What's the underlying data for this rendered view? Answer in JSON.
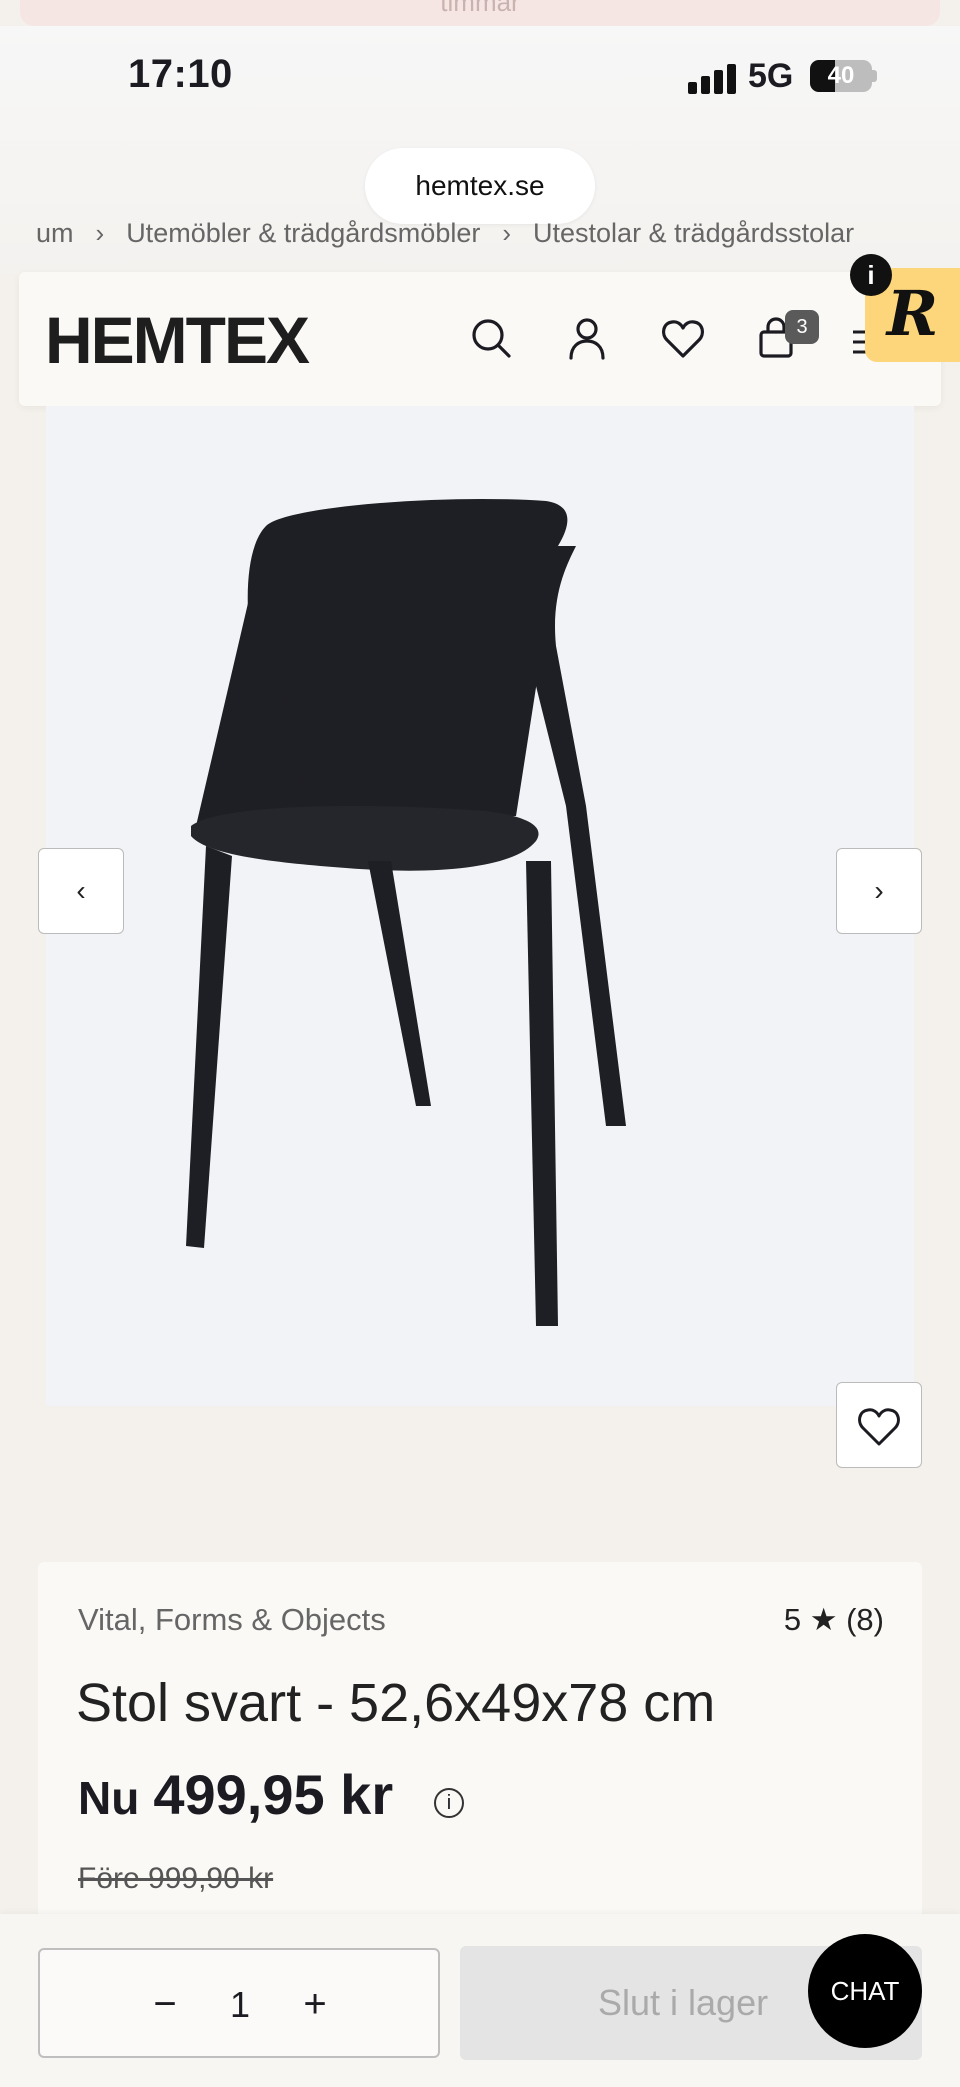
{
  "banner": {
    "text": "timmar"
  },
  "status_bar": {
    "time": "17:10",
    "network": "5G",
    "battery": "40"
  },
  "browser": {
    "url": "hemtex.se"
  },
  "breadcrumb": [
    "um",
    "Utemöbler & trädgårdsmöbler",
    "Utestolar & trädgårdsstolar"
  ],
  "header": {
    "logo": "HEMTEX",
    "cart_count": "3",
    "icons": [
      "search-icon",
      "account-icon",
      "heart-icon",
      "cart-icon",
      "menu-icon"
    ]
  },
  "overlay": {
    "info": "i",
    "badge_letter": "R"
  },
  "gallery": {
    "prev": "‹",
    "next": "›"
  },
  "product": {
    "brand": "Vital, Forms & Objects",
    "rating": "5 ★ (8)",
    "title": "Stol svart - 52,6x49x78 cm",
    "price_prefix": "Nu",
    "price": "499,95 kr",
    "price_info": "i",
    "old_price": "Före 999,90 kr"
  },
  "cart_bar": {
    "minus": "−",
    "quantity": "1",
    "plus": "+",
    "buy_label": "Slut i lager",
    "chat_label": "CHAT"
  }
}
